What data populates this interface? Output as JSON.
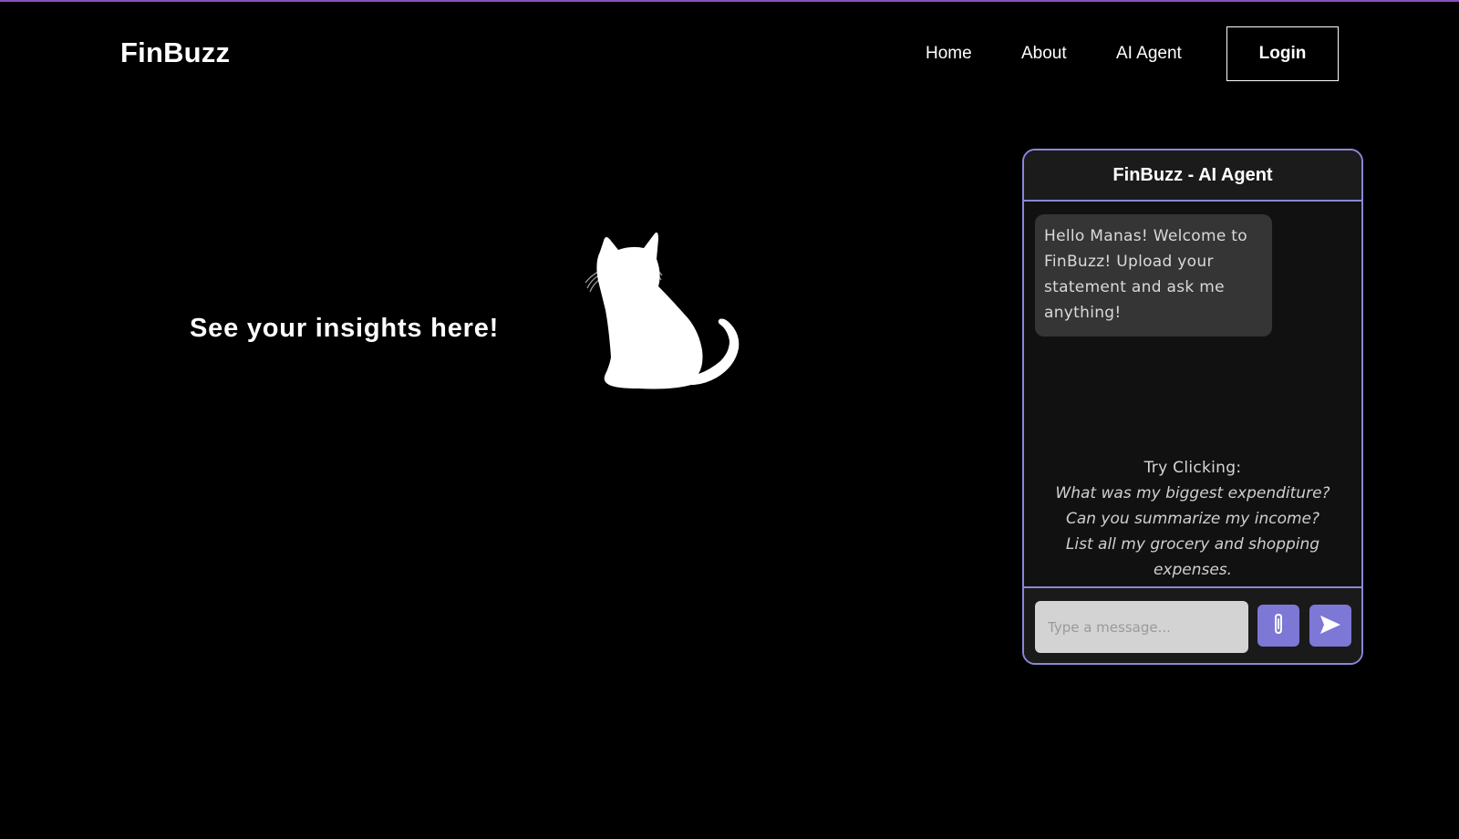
{
  "navbar": {
    "brand": "FinBuzz",
    "links": {
      "home": "Home",
      "about": "About",
      "ai_agent": "AI Agent"
    },
    "login_label": "Login"
  },
  "hero": {
    "headline": "See your insights here!",
    "image_icon": "cat-silhouette-icon"
  },
  "chat": {
    "title": "FinBuzz - AI Agent",
    "welcome_message": "Hello Manas! Welcome to FinBuzz! Upload your statement and ask me anything!",
    "suggestions_heading": "Try Clicking:",
    "suggestions": [
      "What was my biggest expenditure?",
      "Can you summarize my income?",
      "List all my grocery and shopping expenses."
    ],
    "input_placeholder": "Type a message...",
    "attach_icon": "paperclip-icon",
    "send_icon": "send-icon"
  },
  "colors": {
    "background": "#000000",
    "accent": "#8b86d9",
    "button": "#7d77d6",
    "top_bar": "#8a4fc0"
  }
}
